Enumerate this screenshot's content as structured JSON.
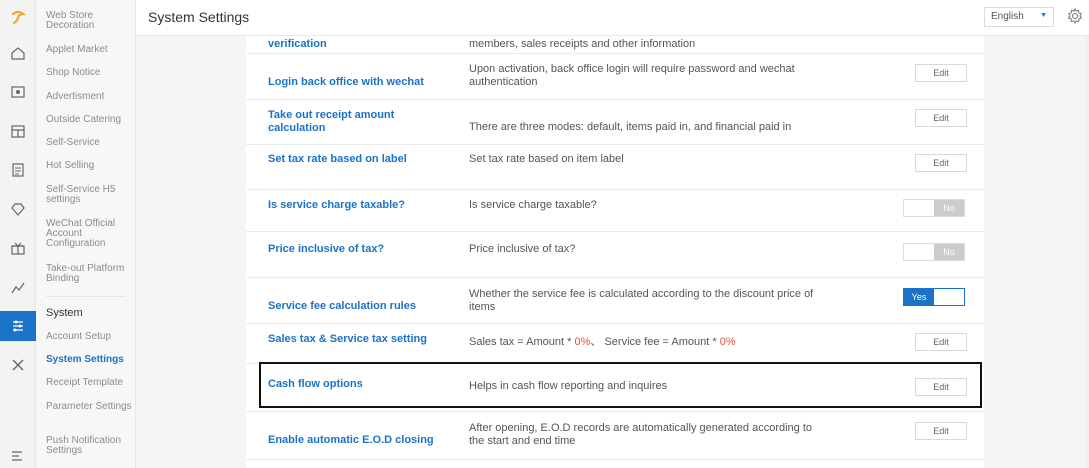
{
  "header": {
    "title": "System Settings",
    "language": "English"
  },
  "subnav": {
    "items": [
      "Web Store Decoration",
      "Applet Market",
      "Shop Notice",
      "Advertisment",
      "Outside Catering",
      "Self-Service",
      "Hot Selling",
      "Self-Service H5 settings",
      "WeChat Official Account Configuration",
      "Take-out Platform Binding"
    ],
    "section_title": "System",
    "section_items": [
      "Account Setup",
      "System Settings",
      "Receipt Template",
      "Parameter Settings",
      "Push Notification Settings"
    ]
  },
  "settings": {
    "rows": [
      {
        "name": "verification",
        "desc": "members, sales receipts and other information",
        "control": "toggle-partial"
      },
      {
        "name": "Login back office with wechat",
        "desc": "Upon activation, back office login will require password and wechat authentication",
        "button": "Edit"
      },
      {
        "name": "Take out receipt amount calculation",
        "desc": "There are three modes: default, items paid in, and financial paid in",
        "button": "Edit"
      },
      {
        "name": "Set tax rate based on label",
        "desc": "Set tax rate based on item label",
        "button": "Edit"
      },
      {
        "name": "Is service charge taxable?",
        "desc": "Is service charge taxable?",
        "toggle": "No"
      },
      {
        "name": "Price inclusive of tax?",
        "desc": "Price inclusive of tax?",
        "toggle": "No"
      },
      {
        "name": "Service fee calculation rules",
        "desc": "Whether the service fee is calculated according to the discount price of items",
        "toggle": "Yes"
      },
      {
        "name": "Sales tax & Service tax setting",
        "desc_prefix": "Sales tax = Amount * ",
        "tax_rate": "0%",
        "desc_mid": "、 Service fee = Amount * ",
        "fee_rate": "0%",
        "button": "Edit"
      },
      {
        "name": "Cash flow options",
        "desc": "Helps in cash flow reporting and inquires",
        "button": "Edit"
      },
      {
        "name": "Enable automatic E.O.D closing",
        "desc": "After opening, E.O.D records are automatically generated according to the start and end time",
        "button": "Edit"
      }
    ]
  },
  "colors": {
    "accent": "#1a73c8",
    "red": "#e84c3d",
    "toggle_off": "#cccccc"
  }
}
